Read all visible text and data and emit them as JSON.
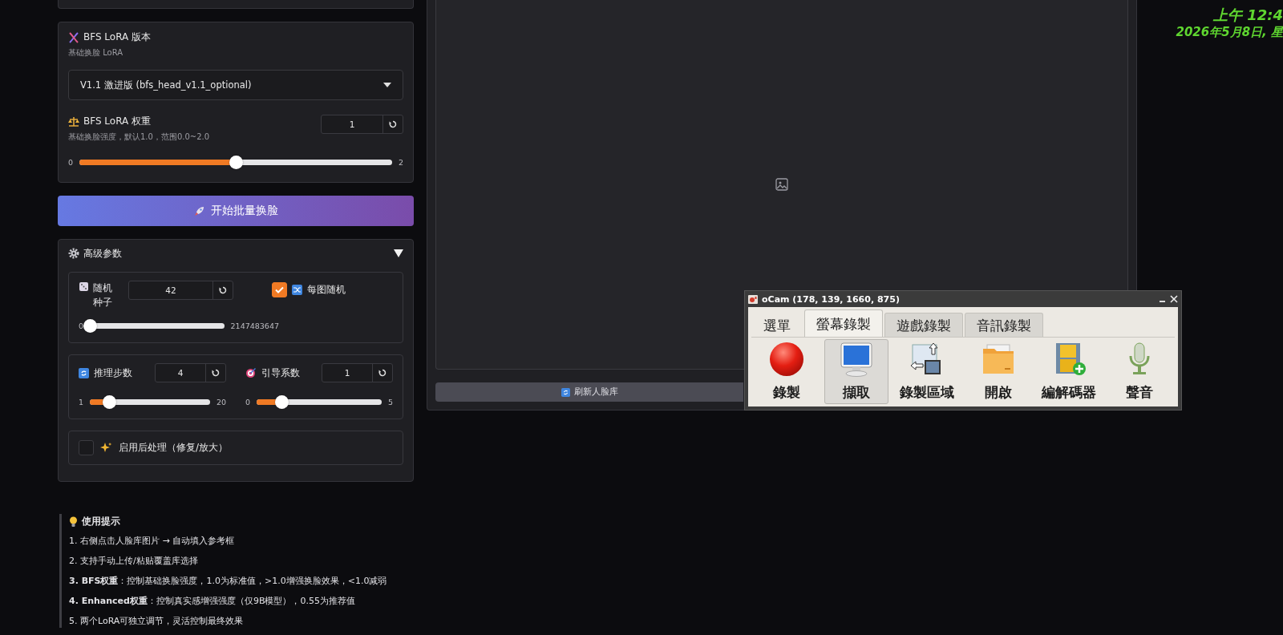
{
  "lora": {
    "title": "BFS LoRA 版本",
    "subtitle": "基础换脸 LoRA",
    "dropdown": {
      "value": "V1.1 激进版 (bfs_head_v1.1_optional)"
    },
    "weight": {
      "label": "BFS LoRA 权重",
      "hint": "基础换脸强度，默认1.0，范围0.0~2.0",
      "value": "1",
      "min": "0",
      "max": "2",
      "level": 0.5
    }
  },
  "start_button": {
    "label": "开始批量换脸"
  },
  "advanced": {
    "title": "高级参数",
    "expanded": true,
    "seed": {
      "label": "随机种子",
      "value": "42",
      "min": "0",
      "max": "2147483647",
      "level": 0
    },
    "random_each": {
      "label": "每图随机",
      "checked": true
    },
    "steps": {
      "label": "推理步数",
      "value": "4",
      "min": "1",
      "max": "20",
      "level": 0.16
    },
    "guidance": {
      "label": "引导系数",
      "value": "1",
      "min": "0",
      "max": "5",
      "level": 0.2
    },
    "postprocess": {
      "label": "启用后处理（修复/放大）",
      "checked": false
    }
  },
  "tips": {
    "title": "使用提示",
    "items": [
      "1. 右侧点击人脸库图片 → 自动填入参考框",
      "2. 支持手动上传/粘贴覆盖库选择",
      "**3. BFS权重**：控制基础换脸强度，1.0为标准值，>1.0增强换脸效果，<1.0减弱",
      "**4. Enhanced权重**：控制真实感增强强度（仅9B模型），0.55为推荐值",
      "5. 两个LoRA可独立调节，灵活控制最终效果"
    ]
  },
  "preview": {
    "refresh_button": {
      "label": "刷新人脸库"
    }
  },
  "clock": {
    "time": "上午 12:4",
    "date": "2026年5月8日, 星"
  },
  "ocam": {
    "title": "oCam (178, 139, 1660, 875)",
    "tabs": [
      {
        "label": "選單",
        "kind": "menu",
        "selected": false
      },
      {
        "label": "螢幕錄製",
        "kind": "tab",
        "selected": true
      },
      {
        "label": "遊戲錄製",
        "kind": "tab",
        "selected": false
      },
      {
        "label": "音訊錄製",
        "kind": "tab",
        "selected": false
      }
    ],
    "tools": [
      {
        "label": "錄製",
        "kind": "record",
        "selected": false
      },
      {
        "label": "擷取",
        "kind": "capture",
        "selected": true
      },
      {
        "label": "錄製區域",
        "kind": "region",
        "selected": false
      },
      {
        "label": "開啟",
        "kind": "open",
        "selected": false
      },
      {
        "label": "編解碼器",
        "kind": "codec",
        "selected": false
      },
      {
        "label": "聲音",
        "kind": "sound",
        "selected": false
      }
    ]
  }
}
